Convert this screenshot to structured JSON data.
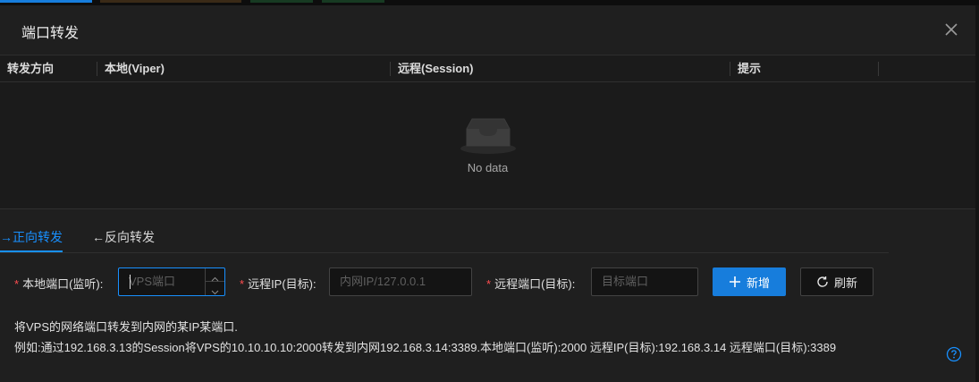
{
  "colors": {
    "accent": "#1890ff",
    "primary_button": "#177ddc",
    "required_star": "#ff4d4f",
    "background": "#1f1f1f"
  },
  "modal": {
    "title": "端口转发",
    "close_icon": "close-icon"
  },
  "table": {
    "columns": [
      "转发方向",
      "本地(Viper)",
      "远程(Session)",
      "提示"
    ],
    "empty_text": "No data",
    "empty_icon": "inbox-icon"
  },
  "tabs": [
    {
      "label": "→正向转发",
      "active": true
    },
    {
      "label": "←反向转发",
      "active": false
    }
  ],
  "form": {
    "local_port": {
      "label": "本地端口(监听):",
      "placeholder": "VPS端口"
    },
    "remote_ip": {
      "label": "远程IP(目标):",
      "placeholder": "内网IP/127.0.0.1"
    },
    "remote_port": {
      "label": "远程端口(目标):",
      "placeholder": "目标端口"
    },
    "add_button": {
      "label": "新增",
      "icon": "plus-icon"
    },
    "refresh_button": {
      "label": "刷新",
      "icon": "refresh-icon"
    }
  },
  "description": {
    "line1": "将VPS的网络端口转发到内网的某IP某端口.",
    "line2": "例如:通过192.168.3.13的Session将VPS的10.10.10.10:2000转发到内网192.168.3.14:3389.本地端口(监听):2000 远程IP(目标):192.168.3.14 远程端口(目标):3389"
  },
  "help_icon": "question-circle-icon"
}
